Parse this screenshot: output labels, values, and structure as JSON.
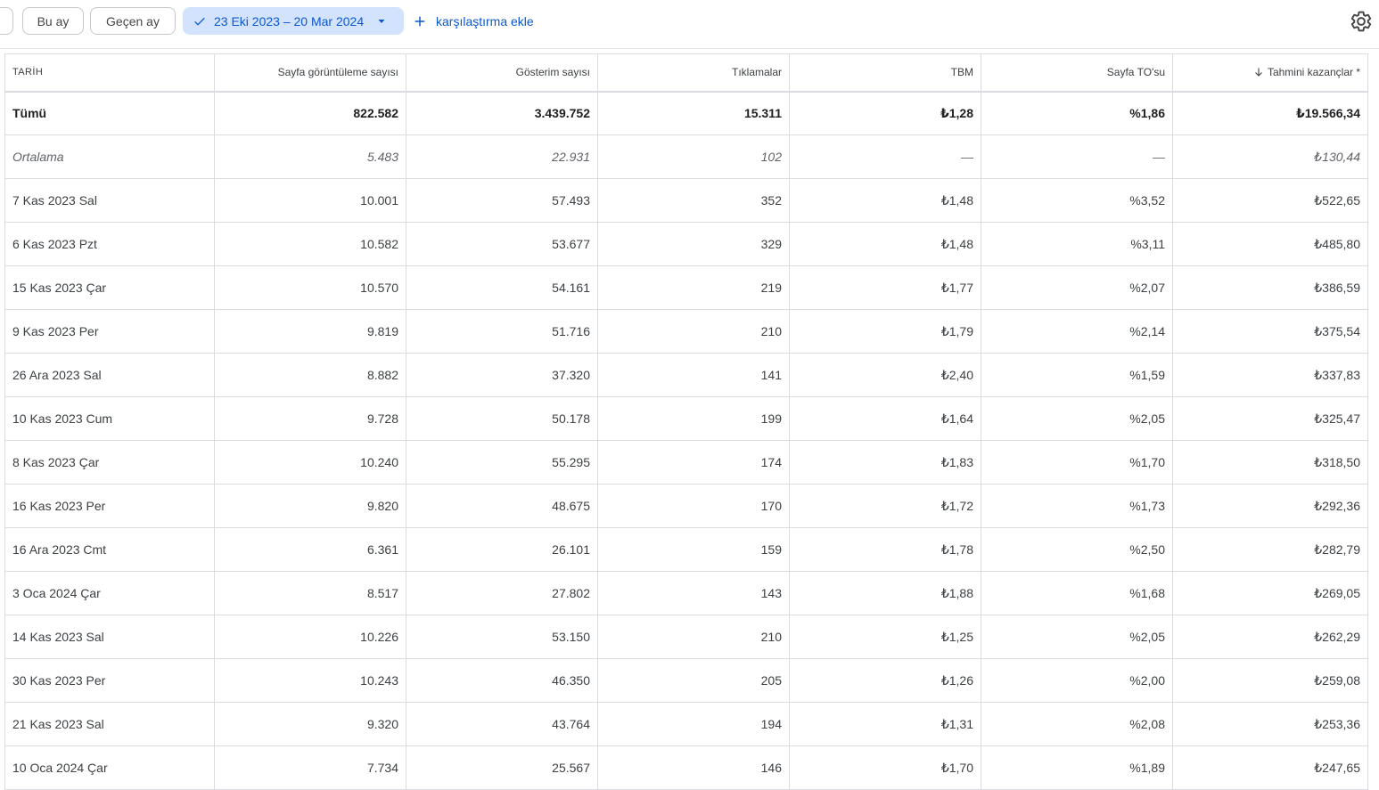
{
  "toolbar": {
    "chips": {
      "this_month": "Bu ay",
      "last_month": "Geçen ay"
    },
    "date_range": "23 Eki 2023 – 20 Mar 2024",
    "add_comparison": "karşılaştırma ekle",
    "icons": {
      "check": "check-icon",
      "caret": "caret-down-icon",
      "plus": "plus-icon",
      "settings": "gear-icon"
    }
  },
  "colors": {
    "accent": "#0b57d0",
    "range_chip_bg": "#d3e3fd",
    "border": "#dadce0"
  },
  "table": {
    "columns": [
      "TARİH",
      "Sayfa görüntüleme sayısı",
      "Gösterim sayısı",
      "Tıklamalar",
      "TBM",
      "Sayfa TO'su",
      "Tahmini kazançlar *"
    ],
    "sorted_column_index": 6,
    "sort_direction": "descending",
    "total": [
      "Tümü",
      "822.582",
      "3.439.752",
      "15.311",
      "₺1,28",
      "%1,86",
      "₺19.566,34"
    ],
    "average": [
      "Ortalama",
      "5.483",
      "22.931",
      "102",
      "—",
      "—",
      "₺130,44"
    ],
    "rows": [
      [
        "7 Kas 2023 Sal",
        "10.001",
        "57.493",
        "352",
        "₺1,48",
        "%3,52",
        "₺522,65"
      ],
      [
        "6 Kas 2023 Pzt",
        "10.582",
        "53.677",
        "329",
        "₺1,48",
        "%3,11",
        "₺485,80"
      ],
      [
        "15 Kas 2023 Çar",
        "10.570",
        "54.161",
        "219",
        "₺1,77",
        "%2,07",
        "₺386,59"
      ],
      [
        "9 Kas 2023 Per",
        "9.819",
        "51.716",
        "210",
        "₺1,79",
        "%2,14",
        "₺375,54"
      ],
      [
        "26 Ara 2023 Sal",
        "8.882",
        "37.320",
        "141",
        "₺2,40",
        "%1,59",
        "₺337,83"
      ],
      [
        "10 Kas 2023 Cum",
        "9.728",
        "50.178",
        "199",
        "₺1,64",
        "%2,05",
        "₺325,47"
      ],
      [
        "8 Kas 2023 Çar",
        "10.240",
        "55.295",
        "174",
        "₺1,83",
        "%1,70",
        "₺318,50"
      ],
      [
        "16 Kas 2023 Per",
        "9.820",
        "48.675",
        "170",
        "₺1,72",
        "%1,73",
        "₺292,36"
      ],
      [
        "16 Ara 2023 Cmt",
        "6.361",
        "26.101",
        "159",
        "₺1,78",
        "%2,50",
        "₺282,79"
      ],
      [
        "3 Oca 2024 Çar",
        "8.517",
        "27.802",
        "143",
        "₺1,88",
        "%1,68",
        "₺269,05"
      ],
      [
        "14 Kas 2023 Sal",
        "10.226",
        "53.150",
        "210",
        "₺1,25",
        "%2,05",
        "₺262,29"
      ],
      [
        "30 Kas 2023 Per",
        "10.243",
        "46.350",
        "205",
        "₺1,26",
        "%2,00",
        "₺259,08"
      ],
      [
        "21 Kas 2023 Sal",
        "9.320",
        "43.764",
        "194",
        "₺1,31",
        "%2,08",
        "₺253,36"
      ],
      [
        "10 Oca 2024 Çar",
        "7.734",
        "25.567",
        "146",
        "₺1,70",
        "%1,89",
        "₺247,65"
      ]
    ]
  }
}
